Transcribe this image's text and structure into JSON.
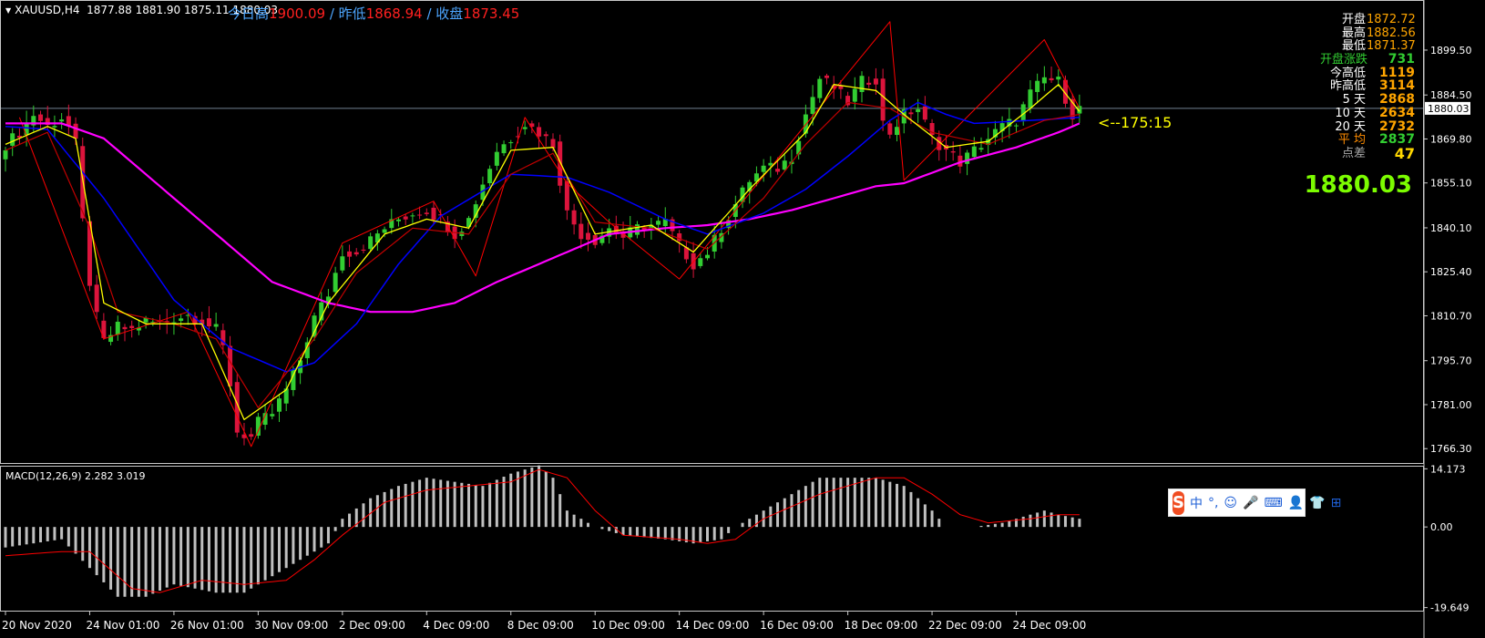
{
  "header": {
    "symbol_tf": "XAUUSD,H4",
    "ohlc": "1877.88 1881.90 1875.11 1880.03"
  },
  "overlay": {
    "today_high_label": "今日高",
    "today_high": "1900.09",
    "yest_low_label": "/ 昨低",
    "yest_low": "1868.94",
    "close_label": "/ 收盘",
    "close": "1873.45"
  },
  "info_panel": [
    {
      "label": "开盘",
      "value": "1872.72",
      "lc": "#ffffff",
      "vc": "#ffa500"
    },
    {
      "label": "最高",
      "value": "1882.56",
      "lc": "#ffffff",
      "vc": "#ffa500"
    },
    {
      "label": "最低",
      "value": "1871.37",
      "lc": "#ffffff",
      "vc": "#ffa500"
    },
    {
      "label": "开盘涨跌",
      "value": "731",
      "lc": "#32cd32",
      "vc": "#32cd32"
    },
    {
      "label": "今高低",
      "value": "1119",
      "lc": "#ffffff",
      "vc": "#ffa500"
    },
    {
      "label": "昨高低",
      "value": "3114",
      "lc": "#ffffff",
      "vc": "#ffa500"
    },
    {
      "label": "5  天",
      "value": "2868",
      "lc": "#ffffff",
      "vc": "#ffa500"
    },
    {
      "label": "10  天",
      "value": "2634",
      "lc": "#ffffff",
      "vc": "#ffa500"
    },
    {
      "label": "20  天",
      "value": "2732",
      "lc": "#ffffff",
      "vc": "#ffa500"
    },
    {
      "label": "平  均",
      "value": "2837",
      "lc": "#ff8c00",
      "vc": "#32cd32"
    },
    {
      "label": "点差",
      "value": "47",
      "lc": "#aaaaaa",
      "vc": "#ffd700"
    }
  ],
  "current_price": "1880.03",
  "timer": "<--175:15",
  "macd": {
    "label": "MACD(12,26,9) 2.282 3.019"
  },
  "ime": {
    "logo": "S",
    "items": [
      "中",
      "°,",
      "☺",
      "🎤",
      "⌨",
      "👤",
      "👕",
      "⊞"
    ]
  },
  "chart_data": {
    "type": "candlestick",
    "symbol": "XAUUSD",
    "timeframe": "H4",
    "price_axis": {
      "ticks": [
        "1899.50",
        "1884.50",
        "1869.80",
        "1855.10",
        "1840.10",
        "1825.40",
        "1810.70",
        "1795.70",
        "1781.00",
        "1766.30"
      ],
      "range": [
        1761.5,
        1913.5
      ]
    },
    "time_axis": {
      "labels": [
        "20 Nov 2020",
        "24 Nov 01:00",
        "26 Nov 01:00",
        "30 Nov 09:00",
        "2 Dec 09:00",
        "4 Dec 09:00",
        "8 Dec 09:00",
        "10 Dec 09:00",
        "14 Dec 09:00",
        "16 Dec 09:00",
        "18 Dec 09:00",
        "22 Dec 09:00",
        "24 Dec 09:00"
      ],
      "label_candle_index": [
        0,
        12,
        24,
        36,
        48,
        60,
        72,
        84,
        96,
        108,
        120,
        132,
        144
      ]
    },
    "close_path": [
      [
        0,
        1868
      ],
      [
        2,
        1872
      ],
      [
        4,
        1878
      ],
      [
        6,
        1874
      ],
      [
        8,
        1877
      ],
      [
        9,
        1874
      ],
      [
        10,
        1868
      ],
      [
        11,
        1842
      ],
      [
        12,
        1822
      ],
      [
        13,
        1810
      ],
      [
        14,
        1802
      ],
      [
        16,
        1807
      ],
      [
        18,
        1806
      ],
      [
        20,
        1809
      ],
      [
        22,
        1808
      ],
      [
        24,
        1810
      ],
      [
        26,
        1811
      ],
      [
        28,
        1809
      ],
      [
        30,
        1806
      ],
      [
        31,
        1800
      ],
      [
        32,
        1788
      ],
      [
        33,
        1772
      ],
      [
        35,
        1770
      ],
      [
        36,
        1775
      ],
      [
        38,
        1778
      ],
      [
        40,
        1786
      ],
      [
        42,
        1796
      ],
      [
        44,
        1810
      ],
      [
        46,
        1818
      ],
      [
        48,
        1832
      ],
      [
        50,
        1832
      ],
      [
        52,
        1836
      ],
      [
        54,
        1840
      ],
      [
        56,
        1843
      ],
      [
        58,
        1845
      ],
      [
        60,
        1846
      ],
      [
        62,
        1843
      ],
      [
        64,
        1838
      ],
      [
        66,
        1843
      ],
      [
        68,
        1855
      ],
      [
        70,
        1866
      ],
      [
        72,
        1870
      ],
      [
        74,
        1875
      ],
      [
        76,
        1872
      ],
      [
        78,
        1868
      ],
      [
        79,
        1856
      ],
      [
        80,
        1845
      ],
      [
        82,
        1838
      ],
      [
        84,
        1836
      ],
      [
        86,
        1840
      ],
      [
        88,
        1837
      ],
      [
        90,
        1840
      ],
      [
        92,
        1841
      ],
      [
        94,
        1842
      ],
      [
        96,
        1834
      ],
      [
        98,
        1828
      ],
      [
        100,
        1832
      ],
      [
        102,
        1840
      ],
      [
        104,
        1848
      ],
      [
        106,
        1856
      ],
      [
        108,
        1860
      ],
      [
        110,
        1860
      ],
      [
        112,
        1864
      ],
      [
        114,
        1878
      ],
      [
        116,
        1890
      ],
      [
        118,
        1887
      ],
      [
        120,
        1882
      ],
      [
        122,
        1889
      ],
      [
        124,
        1890
      ],
      [
        125,
        1875
      ],
      [
        126,
        1872
      ],
      [
        128,
        1878
      ],
      [
        130,
        1880
      ],
      [
        132,
        1870
      ],
      [
        134,
        1866
      ],
      [
        136,
        1862
      ],
      [
        138,
        1866
      ],
      [
        140,
        1870
      ],
      [
        142,
        1874
      ],
      [
        144,
        1876
      ],
      [
        146,
        1885
      ],
      [
        148,
        1890
      ],
      [
        150,
        1889
      ],
      [
        152,
        1878
      ],
      [
        153,
        1880
      ]
    ],
    "ma_fast_path": [
      [
        0,
        1868
      ],
      [
        6,
        1874
      ],
      [
        10,
        1870
      ],
      [
        14,
        1815
      ],
      [
        20,
        1808
      ],
      [
        28,
        1808
      ],
      [
        34,
        1776
      ],
      [
        40,
        1786
      ],
      [
        46,
        1815
      ],
      [
        54,
        1838
      ],
      [
        60,
        1843
      ],
      [
        66,
        1840
      ],
      [
        72,
        1866
      ],
      [
        78,
        1867
      ],
      [
        84,
        1838
      ],
      [
        92,
        1841
      ],
      [
        98,
        1832
      ],
      [
        106,
        1853
      ],
      [
        114,
        1872
      ],
      [
        118,
        1888
      ],
      [
        124,
        1886
      ],
      [
        128,
        1878
      ],
      [
        134,
        1867
      ],
      [
        140,
        1869
      ],
      [
        146,
        1880
      ],
      [
        150,
        1888
      ],
      [
        153,
        1879
      ]
    ],
    "ma_mid_path": [
      [
        0,
        1866
      ],
      [
        6,
        1872
      ],
      [
        12,
        1840
      ],
      [
        16,
        1812
      ],
      [
        24,
        1808
      ],
      [
        30,
        1803
      ],
      [
        36,
        1780
      ],
      [
        44,
        1803
      ],
      [
        50,
        1825
      ],
      [
        58,
        1840
      ],
      [
        66,
        1838
      ],
      [
        72,
        1858
      ],
      [
        78,
        1865
      ],
      [
        84,
        1842
      ],
      [
        92,
        1840
      ],
      [
        100,
        1833
      ],
      [
        108,
        1850
      ],
      [
        114,
        1868
      ],
      [
        120,
        1882
      ],
      [
        126,
        1880
      ],
      [
        132,
        1872
      ],
      [
        140,
        1868
      ],
      [
        148,
        1876
      ],
      [
        153,
        1878
      ]
    ],
    "ma_slow_path": [
      [
        0,
        1874
      ],
      [
        6,
        1873
      ],
      [
        14,
        1850
      ],
      [
        24,
        1816
      ],
      [
        32,
        1800
      ],
      [
        40,
        1792
      ],
      [
        44,
        1795
      ],
      [
        50,
        1808
      ],
      [
        56,
        1828
      ],
      [
        62,
        1844
      ],
      [
        72,
        1858
      ],
      [
        80,
        1857
      ],
      [
        86,
        1852
      ],
      [
        94,
        1843
      ],
      [
        100,
        1838
      ],
      [
        108,
        1845
      ],
      [
        114,
        1853
      ],
      [
        120,
        1864
      ],
      [
        126,
        1876
      ],
      [
        130,
        1882
      ],
      [
        134,
        1878
      ],
      [
        138,
        1875
      ],
      [
        146,
        1876
      ],
      [
        153,
        1877
      ]
    ],
    "ma_long_path": [
      [
        0,
        1875
      ],
      [
        8,
        1875
      ],
      [
        14,
        1870
      ],
      [
        22,
        1854
      ],
      [
        30,
        1838
      ],
      [
        38,
        1822
      ],
      [
        46,
        1815
      ],
      [
        52,
        1812
      ],
      [
        58,
        1812
      ],
      [
        64,
        1815
      ],
      [
        70,
        1822
      ],
      [
        78,
        1830
      ],
      [
        86,
        1838
      ],
      [
        94,
        1840
      ],
      [
        100,
        1841
      ],
      [
        106,
        1843
      ],
      [
        112,
        1846
      ],
      [
        118,
        1850
      ],
      [
        124,
        1854
      ],
      [
        128,
        1855
      ],
      [
        136,
        1862
      ],
      [
        144,
        1867
      ],
      [
        150,
        1872
      ],
      [
        153,
        1875
      ]
    ],
    "zigzag_path": [
      [
        2,
        1877
      ],
      [
        14,
        1803
      ],
      [
        26,
        1812
      ],
      [
        35,
        1767
      ],
      [
        48,
        1835
      ],
      [
        61,
        1849
      ],
      [
        67,
        1824
      ],
      [
        74,
        1877
      ],
      [
        80,
        1855
      ],
      [
        86,
        1842
      ],
      [
        96,
        1823
      ],
      [
        126,
        1909
      ],
      [
        128,
        1856
      ],
      [
        148,
        1903
      ],
      [
        153,
        1880
      ]
    ],
    "current_price": 1880.03,
    "macd": {
      "name": "MACD(12,26,9)",
      "main": 2.282,
      "signal": 3.019,
      "ticks": [
        "14.173",
        "0.00",
        "-19.649"
      ],
      "range": [
        -20.4,
        14.7
      ],
      "hist_path": [
        [
          0,
          -5
        ],
        [
          8,
          -3
        ],
        [
          12,
          -10
        ],
        [
          16,
          -17
        ],
        [
          20,
          -17
        ],
        [
          24,
          -14
        ],
        [
          30,
          -16
        ],
        [
          34,
          -16
        ],
        [
          38,
          -12
        ],
        [
          42,
          -8
        ],
        [
          46,
          -4
        ],
        [
          48,
          2
        ],
        [
          52,
          7
        ],
        [
          56,
          10
        ],
        [
          60,
          12
        ],
        [
          64,
          11
        ],
        [
          68,
          10
        ],
        [
          72,
          13
        ],
        [
          76,
          15
        ],
        [
          78,
          12
        ],
        [
          80,
          4
        ],
        [
          84,
          0
        ],
        [
          88,
          -2
        ],
        [
          94,
          -3
        ],
        [
          98,
          -4
        ],
        [
          102,
          -3
        ],
        [
          104,
          0
        ],
        [
          108,
          4
        ],
        [
          112,
          8
        ],
        [
          116,
          12
        ],
        [
          120,
          12
        ],
        [
          124,
          12
        ],
        [
          128,
          10
        ],
        [
          132,
          4
        ],
        [
          134,
          0
        ],
        [
          138,
          0
        ],
        [
          142,
          1
        ],
        [
          146,
          3
        ],
        [
          148,
          4
        ],
        [
          150,
          3
        ],
        [
          153,
          2
        ]
      ],
      "signal_path": [
        [
          0,
          -7
        ],
        [
          8,
          -6
        ],
        [
          12,
          -6
        ],
        [
          18,
          -15
        ],
        [
          22,
          -16
        ],
        [
          28,
          -13
        ],
        [
          34,
          -14
        ],
        [
          40,
          -13
        ],
        [
          44,
          -8
        ],
        [
          48,
          -2
        ],
        [
          54,
          6
        ],
        [
          60,
          9
        ],
        [
          66,
          10
        ],
        [
          72,
          11
        ],
        [
          76,
          14
        ],
        [
          80,
          12
        ],
        [
          84,
          4
        ],
        [
          88,
          -2
        ],
        [
          96,
          -3
        ],
        [
          100,
          -4
        ],
        [
          104,
          -3
        ],
        [
          108,
          2
        ],
        [
          116,
          8
        ],
        [
          120,
          10
        ],
        [
          124,
          12
        ],
        [
          128,
          12
        ],
        [
          132,
          8
        ],
        [
          136,
          3
        ],
        [
          140,
          1
        ],
        [
          146,
          2
        ],
        [
          150,
          3
        ],
        [
          153,
          3
        ]
      ]
    },
    "colors": {
      "bull": "#32cd32",
      "bear": "#dc143c",
      "ma_fast": "#ffff00",
      "ma_mid": "#c00000",
      "ma_slow": "#0000ff",
      "ma_long": "#ff00ff",
      "zigzag": "#ff0000",
      "macd_hist": "#c0c0c0",
      "macd_signal": "#ff0000"
    }
  }
}
